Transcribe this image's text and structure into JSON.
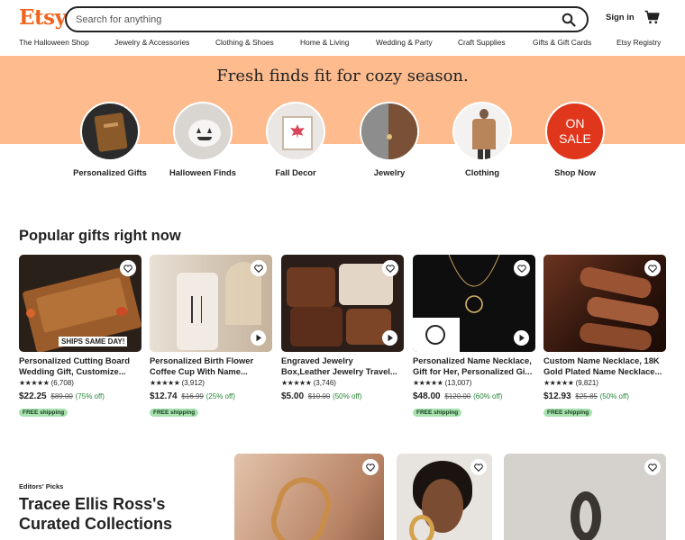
{
  "header": {
    "logo": "Etsy",
    "search_placeholder": "Search for anything",
    "signin_label": "Sign in",
    "nav": [
      "The Halloween Shop",
      "Jewelry & Accessories",
      "Clothing & Shoes",
      "Home & Living",
      "Wedding & Party",
      "Craft Supplies",
      "Gifts & Gift Cards",
      "Etsy Registry"
    ]
  },
  "hero": {
    "title": "Fresh finds fit for cozy season.",
    "categories": [
      {
        "label": "Personalized Gifts"
      },
      {
        "label": "Halloween Finds"
      },
      {
        "label": "Fall Decor"
      },
      {
        "label": "Jewelry"
      },
      {
        "label": "Clothing"
      },
      {
        "label": "Shop Now",
        "sale_line1": "ON",
        "sale_line2": "SALE"
      }
    ]
  },
  "popular": {
    "title": "Popular gifts right now",
    "items": [
      {
        "title": "Personalized Cutting Board Wedding Gift, Customize...",
        "stars": "★★★★★",
        "reviews": "(6,708)",
        "price": "$22.25",
        "orig": "$89.00",
        "disc": "(75% off)",
        "badge": "FREE shipping",
        "overlay": "SHIPS SAME DAY!"
      },
      {
        "title": "Personalized Birth Flower Coffee Cup With Name...",
        "stars": "★★★★★",
        "reviews": "(3,912)",
        "price": "$12.74",
        "orig": "$16.99",
        "disc": "(25% off)",
        "badge": "FREE shipping"
      },
      {
        "title": "Engraved Jewelry Box,Leather Jewelry Travel...",
        "stars": "★★★★★",
        "reviews": "(3,746)",
        "price": "$5.00",
        "orig": "$10.00",
        "disc": "(50% off)",
        "badge": ""
      },
      {
        "title": "Personalized Name Necklace, Gift for Her, Personalized Gi...",
        "stars": "★★★★★",
        "reviews": "(13,007)",
        "price": "$48.00",
        "orig": "$120.00",
        "disc": "(60% off)",
        "badge": "FREE shipping"
      },
      {
        "title": "Custom Name Necklace, 18K Gold Plated Name Necklace...",
        "stars": "★★★★★",
        "reviews": "(9,821)",
        "price": "$12.93",
        "orig": "$25.85",
        "disc": "(50% off)",
        "badge": "FREE shipping"
      }
    ]
  },
  "editors": {
    "small": "Editors' Picks",
    "title": "Tracee Ellis Ross's Curated Collections"
  },
  "colors": {
    "brand": "#f1641e",
    "hero_bg": "#fdbb8e",
    "sale": "#e0361c",
    "badge_bg": "#a6e1ae"
  }
}
